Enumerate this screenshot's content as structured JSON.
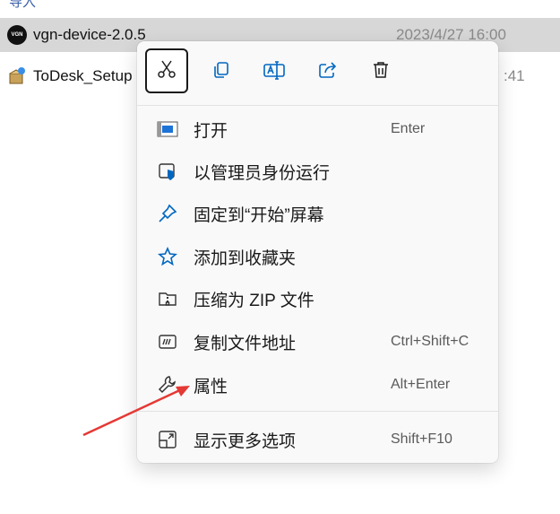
{
  "top_fragment": "导入",
  "files": [
    {
      "name": "vgn-device-2.0.5",
      "date": "2023/4/27 16:00",
      "logo_text": "VGN"
    },
    {
      "name": "ToDesk_Setup",
      "date": ":41"
    }
  ],
  "toolbar": [
    {
      "icon": "scissors-icon",
      "name": "cut-button"
    },
    {
      "icon": "copy-icon",
      "name": "copy-button"
    },
    {
      "icon": "rename-icon",
      "name": "rename-button"
    },
    {
      "icon": "share-icon",
      "name": "share-button"
    },
    {
      "icon": "trash-icon",
      "name": "delete-button"
    }
  ],
  "menu_items": [
    {
      "label": "打开",
      "shortcut": "Enter",
      "icon": "open-window-icon"
    },
    {
      "label": "以管理员身份运行",
      "shortcut": "",
      "icon": "admin-shield-icon"
    },
    {
      "label": "固定到“开始”屏幕",
      "shortcut": "",
      "icon": "pin-icon"
    },
    {
      "label": "添加到收藏夹",
      "shortcut": "",
      "icon": "star-icon"
    },
    {
      "label": "压缩为 ZIP 文件",
      "shortcut": "",
      "icon": "zip-folder-icon"
    },
    {
      "label": "复制文件地址",
      "shortcut": "Ctrl+Shift+C",
      "icon": "copy-path-icon"
    },
    {
      "label": "属性",
      "shortcut": "Alt+Enter",
      "icon": "wrench-icon"
    },
    {
      "label": "显示更多选项",
      "shortcut": "Shift+F10",
      "icon": "more-options-icon"
    }
  ],
  "colors": {
    "accent": "#0067c0",
    "selection": "#d7d7d7",
    "annotation_arrow": "#e53935"
  }
}
